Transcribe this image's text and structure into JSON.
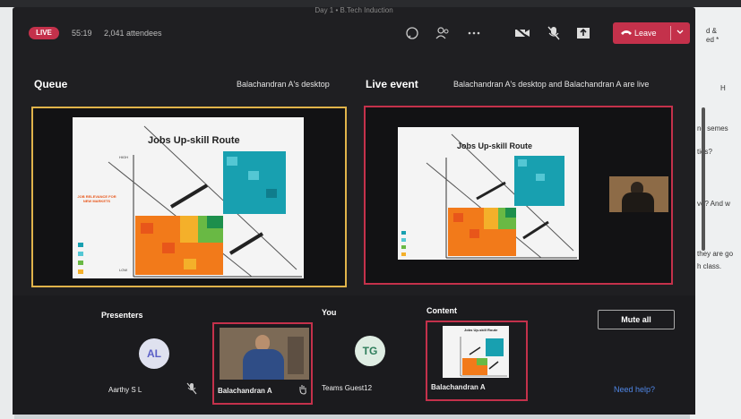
{
  "window": {
    "title": "Day 1 • B.Tech Induction"
  },
  "topbar": {
    "live_badge": "LIVE",
    "timer": "55:19",
    "attendees": "2,041 attendees",
    "leave_label": "Leave"
  },
  "queue": {
    "title": "Queue",
    "source": "Balachandran A's desktop"
  },
  "live_event": {
    "title": "Live event",
    "status": "Balachandran A's desktop and Balachandran A are live"
  },
  "slide": {
    "title": "Jobs Up-skill Route",
    "ylabel": "JOB RELEVANCE FOR NEW MARKETS",
    "axis_high": "HIGH",
    "axis_low": "LOW"
  },
  "bottom": {
    "presenters_label": "Presenters",
    "you_label": "You",
    "content_label": "Content",
    "mute_all": "Mute all",
    "need_help": "Need help?",
    "presenters": [
      {
        "initials": "AL",
        "name": "Aarthy S L"
      },
      {
        "name": "Balachandran A"
      }
    ],
    "you": {
      "initials": "TG",
      "name": "Teams Guest12"
    },
    "content": {
      "name": "Balachandran A"
    }
  },
  "background_app": {
    "cells": [
      "d &",
      "ed *",
      "H",
      "nd semes",
      "ties?",
      "ve? And w",
      "they are go",
      "h class."
    ]
  },
  "colors": {
    "live_red": "#c4314b",
    "queue_border": "#e0b34a",
    "teal": "#18a0b0",
    "orange": "#f27a1a",
    "green": "#69b944"
  }
}
